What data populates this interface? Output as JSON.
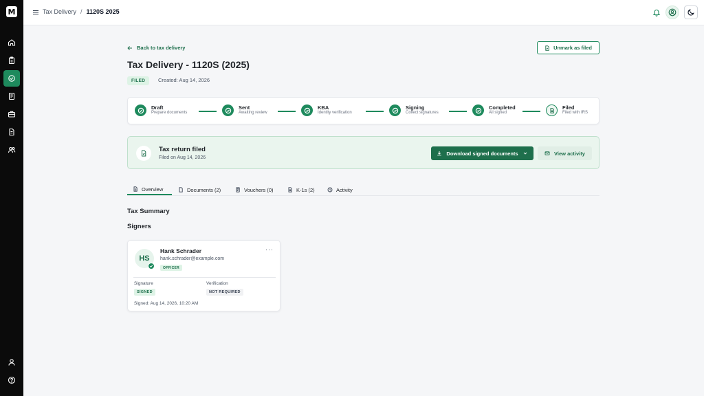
{
  "header": {
    "breadcrumb": [
      "Tax Delivery",
      "1120S 2025"
    ],
    "separator": "/"
  },
  "page": {
    "back_link": "Back to tax delivery",
    "unmark_button": "Unmark as filed",
    "title": "Tax Delivery - 1120S (2025)",
    "status_badge": "FILED",
    "created": "Created: Aug 14, 2026"
  },
  "stepper": [
    {
      "label": "Draft",
      "sub": "Prepare documents"
    },
    {
      "label": "Sent",
      "sub": "Awaiting review"
    },
    {
      "label": "KBA",
      "sub": "Identity verification"
    },
    {
      "label": "Signing",
      "sub": "Collect signatures"
    },
    {
      "label": "Completed",
      "sub": "All signed"
    },
    {
      "label": "Filed",
      "sub": "Filed with IRS"
    }
  ],
  "banner": {
    "title": "Tax return filed",
    "sub": "Filed on Aug 14, 2026",
    "download_button": "Download signed documents",
    "activity_button": "View activity"
  },
  "tabs": [
    {
      "label": "Overview"
    },
    {
      "label": "Documents (2)"
    },
    {
      "label": "Vouchers (0)"
    },
    {
      "label": "K-1s (2)"
    },
    {
      "label": "Activity"
    }
  ],
  "sections": {
    "tax_summary": "Tax Summary",
    "signers": "Signers"
  },
  "signer": {
    "initials": "HS",
    "name": "Hank Schrader",
    "email": "hank.schrader@example.com",
    "role": "OFFICER",
    "more": "···",
    "signature_label": "Signature",
    "signature_value": "SIGNED",
    "verification_label": "Verification",
    "verification_value": "NOT REQUIRED",
    "signed_at": "Signed: Aug 14, 2026, 10:20 AM"
  },
  "brand": {
    "logo_text": "M",
    "accent": "#1e8a5d",
    "accent_dark": "#1e6f4c",
    "sidebar_bg": "#0b0b0b"
  }
}
